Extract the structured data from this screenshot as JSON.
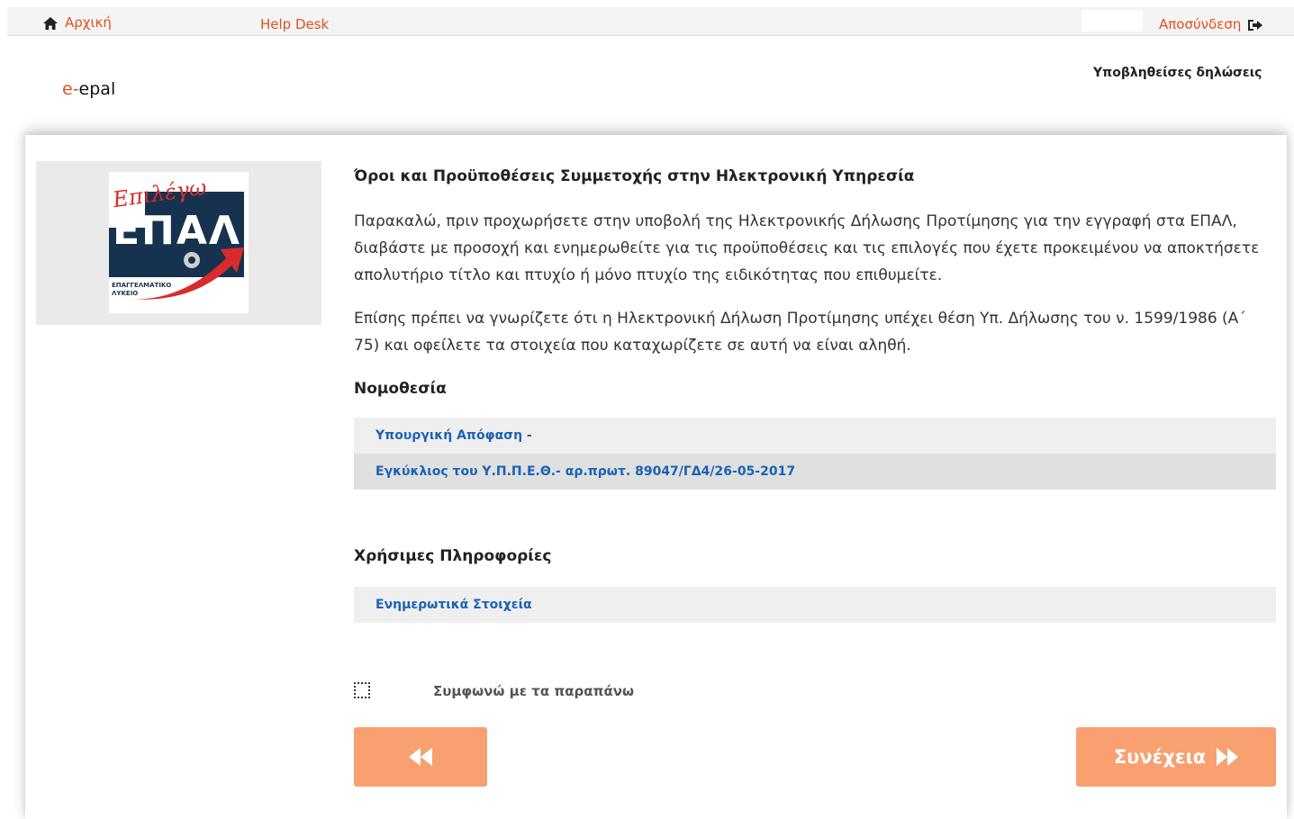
{
  "topbar": {
    "home_label": "Αρχική",
    "helpdesk_label": "Help Desk",
    "logout_label": "Αποσύνδεση"
  },
  "header": {
    "brand_prefix": "e-",
    "brand_name": "epal",
    "submitted_link": "Υποβληθείσες δηλώσεις"
  },
  "logo": {
    "script_text": "Επιλέγω",
    "big_text": "ΕΠΑΛ",
    "sub_line1": "ΕΠΑΓΓΕΛΜΑΤΙΚΟ",
    "sub_line2": "ΛΥΚΕΙΟ"
  },
  "main": {
    "title": "Όροι και Προϋποθέσεις Συμμετοχής στην Ηλεκτρονική Υπηρεσία",
    "paragraph1": "Παρακαλώ, πριν προχωρήσετε στην υποβολή της Ηλεκτρονικής Δήλωσης Προτίμησης για την εγγραφή στα ΕΠΑΛ, διαβάστε με προσοχή και ενημερωθείτε για τις προϋποθέσεις και τις επιλογές που έχετε προκειμένου να αποκτήσετε απολυτήριο τίτλο και πτυχίο ή μόνο πτυχίο της ειδικότητας που επιθυμείτε.",
    "paragraph2": "Επίσης πρέπει να γνωρίζετε ότι η Ηλεκτρονική Δήλωση Προτίμησης υπέχει θέση Υπ. Δήλωσης του ν. 1599/1986 (Α΄ 75) και οφείλετε τα στοιχεία που καταχωρίζετε σε αυτή να είναι αληθή.",
    "legislation_heading": "Νομοθεσία",
    "legislation_items": [
      "Υπουργική Απόφαση -",
      "Εγκύκλιος του Υ.Π.Π.Ε.Θ.- αρ.πρωτ. 89047/ΓΔ4/26-05-2017"
    ],
    "info_heading": "Χρήσιμες Πληροφορίες",
    "info_items": [
      "Ενημερωτικά Στοιχεία"
    ],
    "agree_label": "Συμφωνώ με τα παραπάνω",
    "agree_checked": false,
    "next_label": "Συνέχεια"
  },
  "colors": {
    "accent": "#e0511f",
    "button": "#f8a06f",
    "link": "#1a62b5"
  },
  "icons": {
    "home": "home-icon",
    "logout": "sign-out-icon",
    "back": "fast-backward-icon",
    "next": "fast-forward-icon"
  }
}
